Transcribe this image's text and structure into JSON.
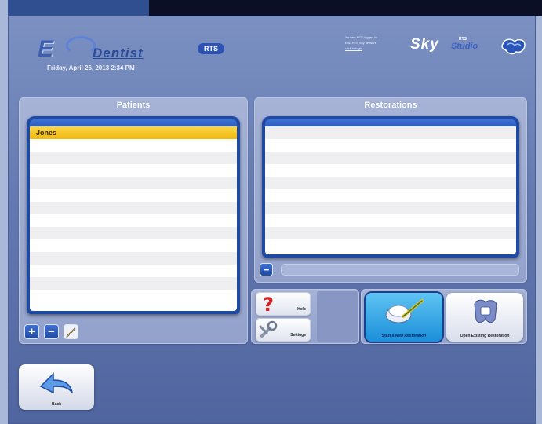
{
  "header": {
    "logo_letter": "E",
    "logo_word": "Dentist",
    "logo_badge": "RTS",
    "datetime": "Friday, April 26, 2013  2:34 PM"
  },
  "brand": {
    "tag_lines": [
      "You are NOT logged to",
      "E4D RTS Sky network",
      "click to login"
    ],
    "sky": "Sky",
    "sub": "RTS",
    "rts": "Studio"
  },
  "patients": {
    "title": "Patients",
    "rows": [
      "Jones",
      "",
      "",
      "",
      "",
      "",
      "",
      "",
      "",
      "",
      "",
      "",
      "",
      ""
    ],
    "selected_index": 0
  },
  "restorations": {
    "title": "Restorations",
    "rows": [
      "",
      "",
      "",
      "",
      "",
      "",
      "",
      "",
      "",
      ""
    ]
  },
  "actions": {
    "help": "Help",
    "settings": "Settings",
    "start_new": "Start a New Restoration",
    "open_existing": "Open Existing Restoration",
    "back": "Back"
  },
  "colors": {
    "accent": "#1f4aa3",
    "selected_row": "#f1b80f",
    "active_button": "#2fa6e6"
  }
}
